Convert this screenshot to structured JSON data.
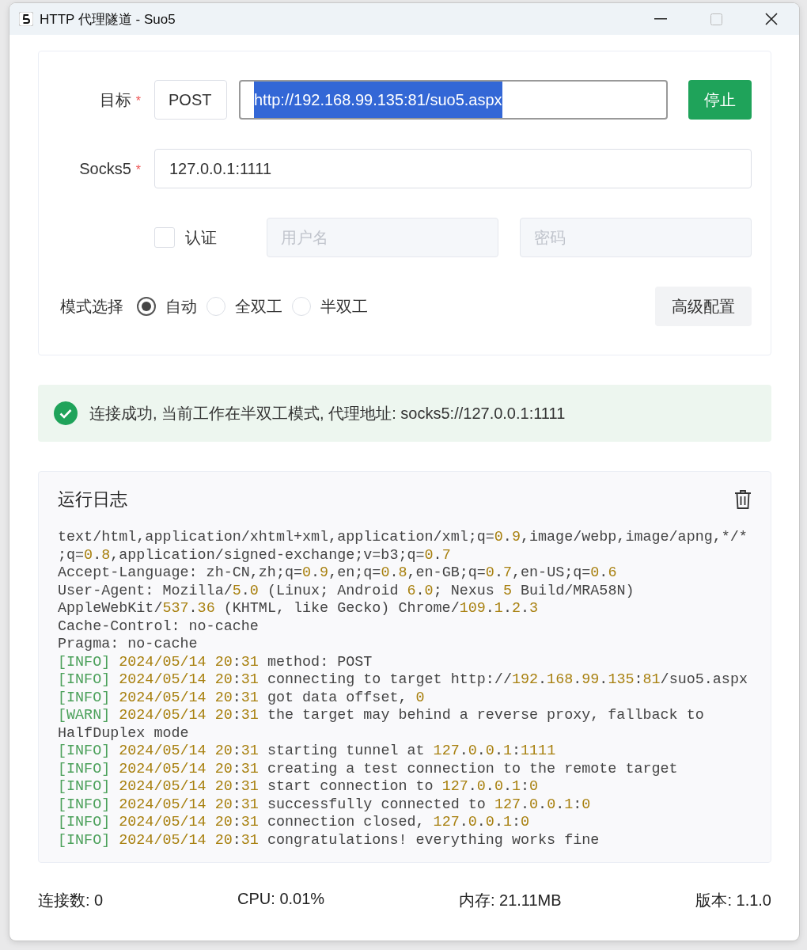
{
  "window": {
    "title": "HTTP 代理隧道 - Suo5"
  },
  "form": {
    "target": {
      "label": "目标",
      "required_mark": "*",
      "method": "POST",
      "url": "http://192.168.99.135:81/suo5.aspx",
      "url_text_selected": true,
      "button": "停止"
    },
    "socks5": {
      "label": "Socks5",
      "required_mark": "*",
      "value": "127.0.0.1:1111"
    },
    "auth": {
      "label": "认证",
      "checked": false,
      "username_placeholder": "用户名",
      "password_placeholder": "密码",
      "disabled": true
    },
    "mode": {
      "label": "模式选择",
      "options": [
        {
          "label": "自动",
          "selected": true
        },
        {
          "label": "全双工",
          "selected": false
        },
        {
          "label": "半双工",
          "selected": false
        }
      ],
      "advanced_button": "高级配置"
    }
  },
  "alert": {
    "kind": "success",
    "text": "连接成功, 当前工作在半双工模式, 代理地址: socks5://127.0.0.1:1111"
  },
  "log": {
    "title": "运行日志",
    "lines": [
      {
        "text": "text/html,application/xhtml+xml,application/xml;q=0.9,image/webp,image/apng,*/*;q=0.8,application/signed-exchange;v=b3;q=0.7"
      },
      {
        "text": "Accept-Language: zh-CN,zh;q=0.9,en;q=0.8,en-GB;q=0.7,en-US;q=0.6"
      },
      {
        "text": "User-Agent: Mozilla/5.0 (Linux; Android 6.0; Nexus 5 Build/MRA58N)"
      },
      {
        "text": "AppleWebKit/537.36 (KHTML, like Gecko) Chrome/109.1.2.3"
      },
      {
        "text": "Cache-Control: no-cache"
      },
      {
        "text": "Pragma: no-cache"
      },
      {
        "tag": "[INFO]",
        "time": "2024/05/14 20:31",
        "text": "method: POST"
      },
      {
        "tag": "[INFO]",
        "time": "2024/05/14 20:31",
        "text": "connecting to target http://192.168.99.135:81/suo5.aspx"
      },
      {
        "tag": "[INFO]",
        "time": "2024/05/14 20:31",
        "text": "got data offset, 0"
      },
      {
        "tag": "[WARN]",
        "time": "2024/05/14 20:31",
        "text": "the target may behind a reverse proxy, fallback to HalfDuplex mode"
      },
      {
        "tag": "[INFO]",
        "time": "2024/05/14 20:31",
        "text": "starting tunnel at 127.0.0.1:1111"
      },
      {
        "tag": "[INFO]",
        "time": "2024/05/14 20:31",
        "text": "creating a test connection to the remote target"
      },
      {
        "tag": "[INFO]",
        "time": "2024/05/14 20:31",
        "text": "start connection to 127.0.0.1:0"
      },
      {
        "tag": "[INFO]",
        "time": "2024/05/14 20:31",
        "text": "successfully connected to 127.0.0.1:0"
      },
      {
        "tag": "[INFO]",
        "time": "2024/05/14 20:31",
        "text": "connection closed, 127.0.0.1:0"
      },
      {
        "tag": "[INFO]",
        "time": "2024/05/14 20:31",
        "text": "congratulations! everything works fine"
      }
    ]
  },
  "status_bar": [
    "连接数: 0",
    "CPU: 0.01%",
    "内存: 21.11MB",
    "版本: 1.1.0"
  ]
}
